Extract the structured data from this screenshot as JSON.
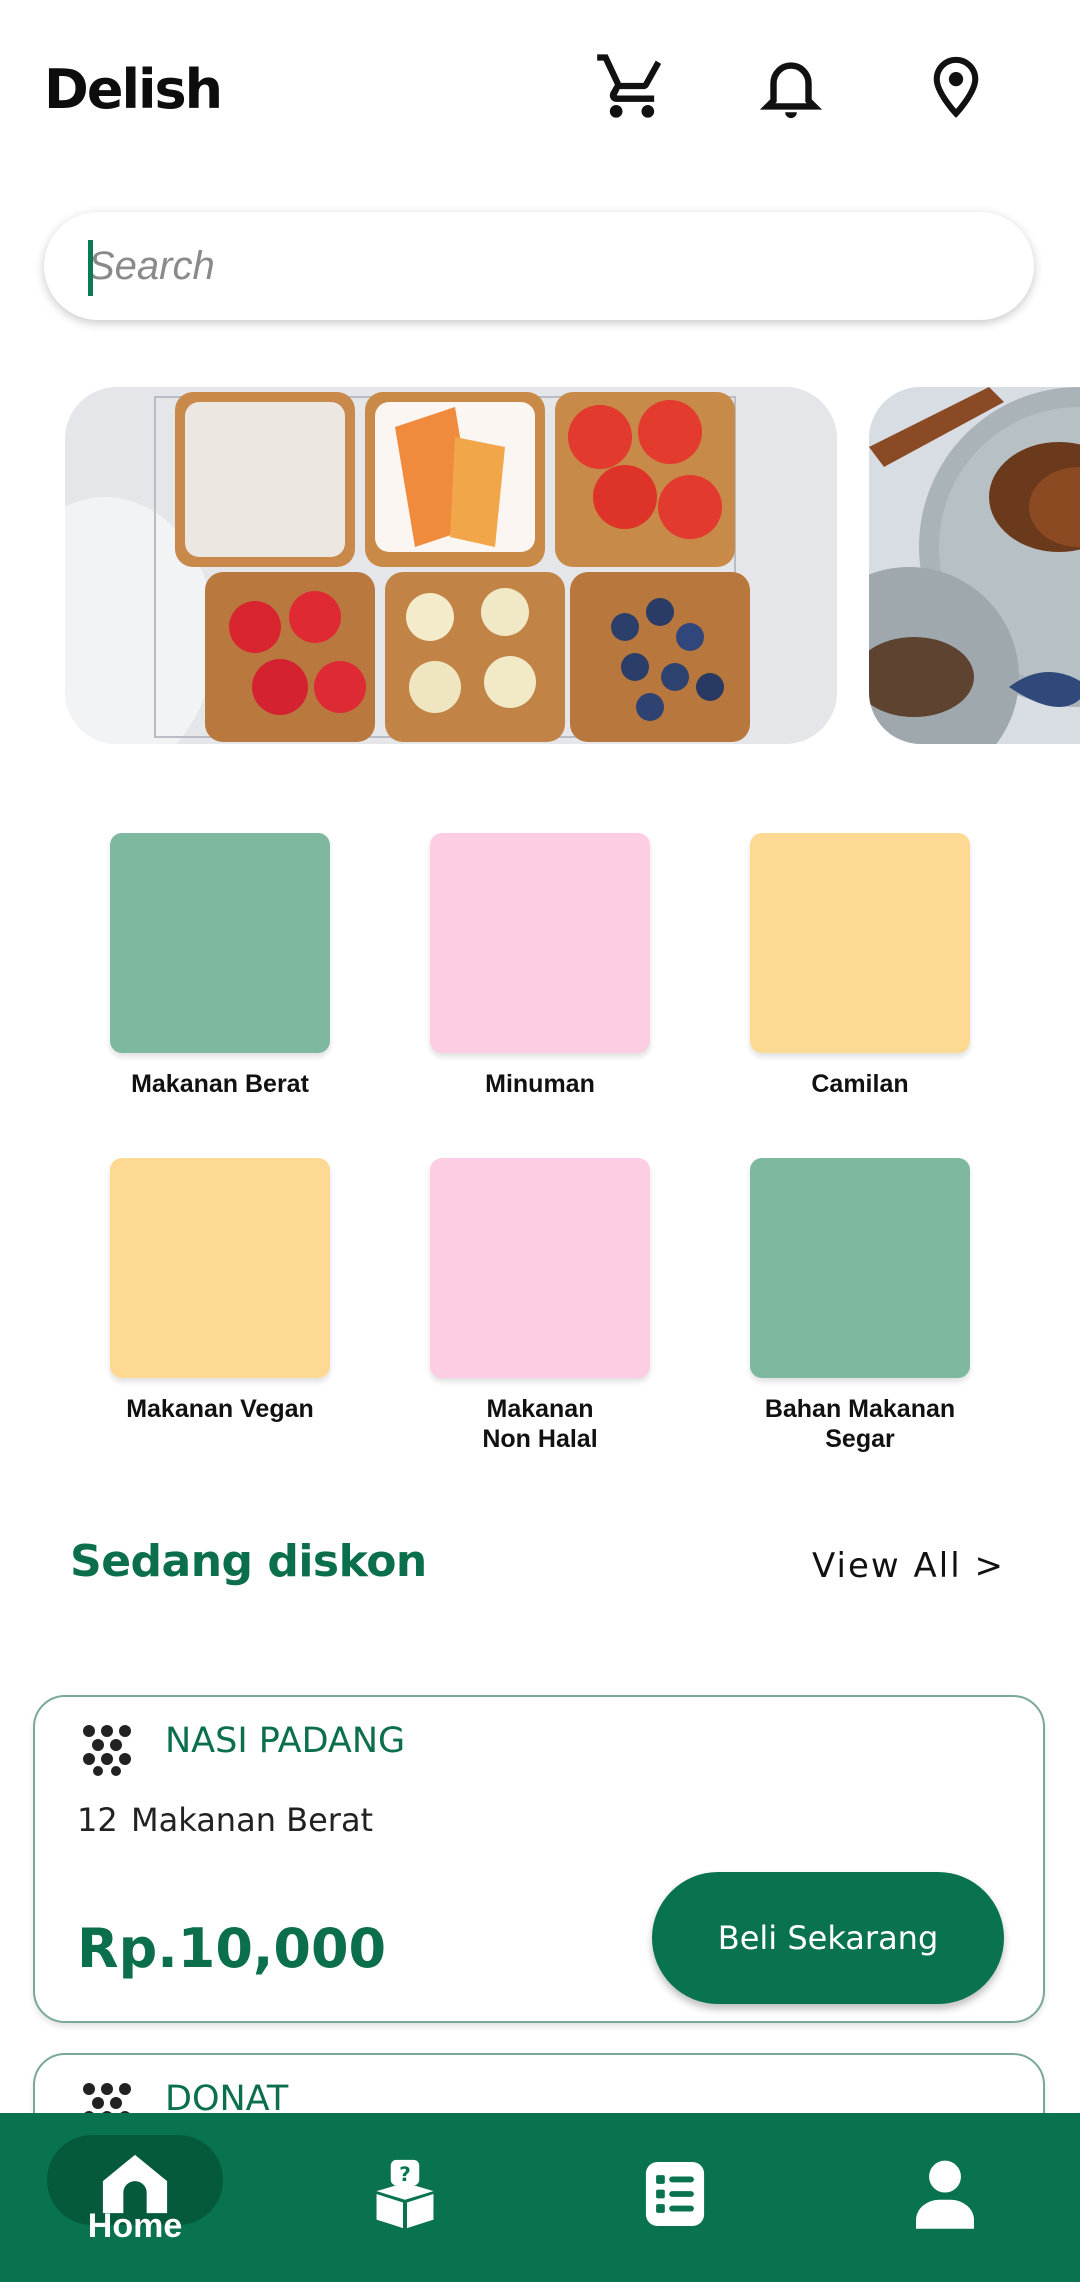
{
  "header": {
    "brand": "Delish"
  },
  "header_icons": [
    "cart-icon",
    "bell-icon",
    "location-pin-icon"
  ],
  "search": {
    "placeholder": "Search",
    "value": ""
  },
  "banners": [
    {
      "name": "toast-platter-banner"
    },
    {
      "name": "steak-plate-banner"
    }
  ],
  "categories": [
    {
      "label": "Makanan Berat",
      "color": "#7db89f"
    },
    {
      "label": "Minuman",
      "color": "#fccde3"
    },
    {
      "label": "Camilan",
      "color": "#fdd993"
    },
    {
      "label": "Makanan Vegan",
      "color": "#fdd993"
    },
    {
      "label": "Makanan\nNon Halal",
      "color": "#fccde3"
    },
    {
      "label": "Bahan Makanan\nSegar",
      "color": "#7db89f"
    }
  ],
  "discount": {
    "title": "Sedang diskon",
    "view_all": "View All >"
  },
  "products": [
    {
      "name": "NASI PADANG",
      "qty": "12",
      "category": "Makanan Berat",
      "price": "Rp.10,000",
      "button": "Beli Sekarang"
    },
    {
      "name": "DONAT"
    }
  ],
  "bottom_nav": {
    "home_label": "Home"
  },
  "colors": {
    "brand_green": "#08734e",
    "text_green": "#0b6f4b"
  }
}
